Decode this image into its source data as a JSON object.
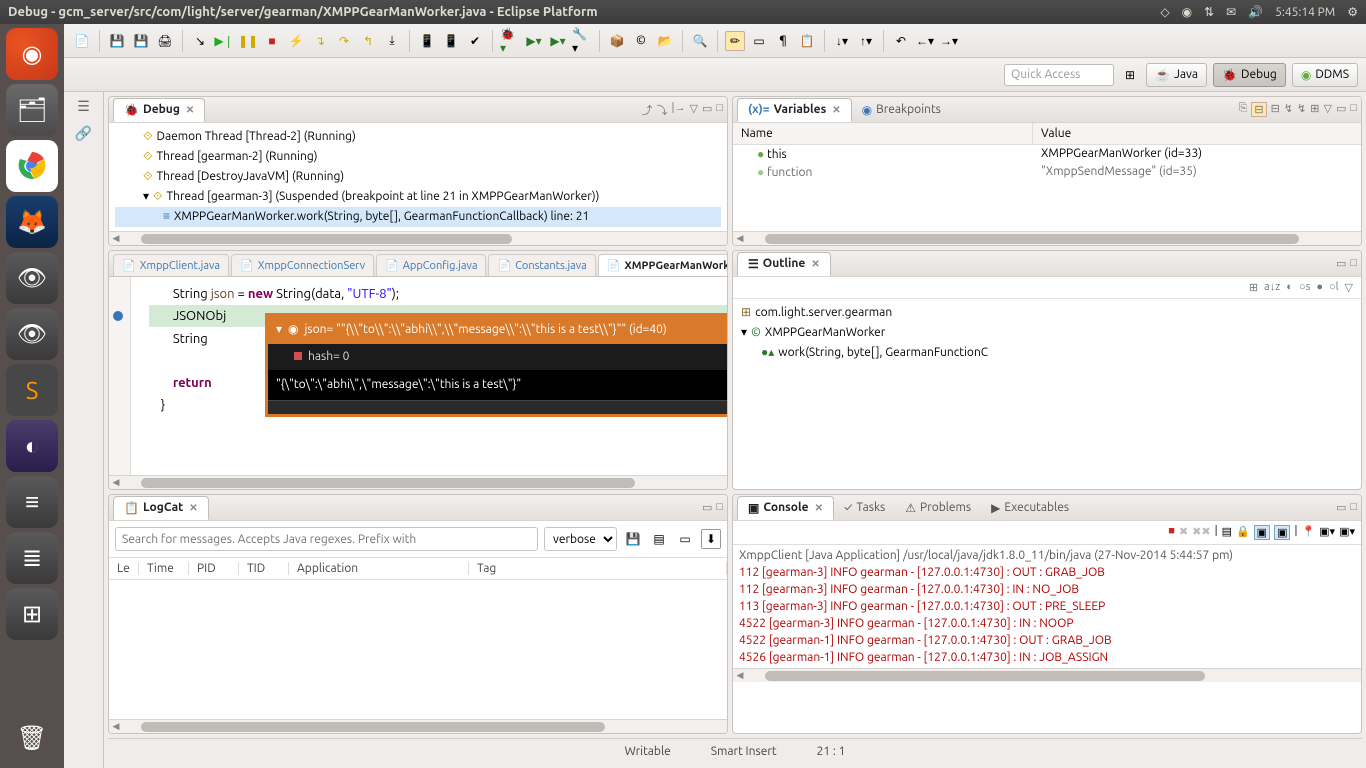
{
  "window_title": "Debug - gcm_server/src/com/light/server/gearman/XMPPGearManWorker.java - Eclipse Platform",
  "time": "5:45:14 PM",
  "quick_access": "Quick Access",
  "perspectives": {
    "java": "Java",
    "debug": "Debug",
    "ddms": "DDMS"
  },
  "debug_view": {
    "title": "Debug",
    "threads": [
      {
        "label": "Daemon Thread [Thread-2] (Running)",
        "indent": 1,
        "icon": "thread"
      },
      {
        "label": "Thread [gearman-2] (Running)",
        "indent": 1,
        "icon": "thread"
      },
      {
        "label": "Thread [DestroyJavaVM] (Running)",
        "indent": 1,
        "icon": "thread"
      },
      {
        "label": "Thread [gearman-3] (Suspended (breakpoint at line 21 in XMPPGearManWorker))",
        "indent": 1,
        "icon": "thread-susp"
      },
      {
        "label": "XMPPGearManWorker.work(String, byte[], GearmanFunctionCallback) line: 21",
        "indent": 2,
        "icon": "frame",
        "sel": true
      }
    ]
  },
  "variables_view": {
    "title": "Variables",
    "breakpoints_tab": "Breakpoints",
    "col_name": "Name",
    "col_value": "Value",
    "rows": [
      {
        "name": "this",
        "value": "XMPPGearManWorker  (id=33)",
        "icon": "●"
      },
      {
        "name": "function",
        "value": "\"XmppSendMessage\" (id=35)",
        "icon": "●"
      }
    ]
  },
  "editor": {
    "tabs": [
      {
        "label": "XmppClient.java"
      },
      {
        "label": "XmppConnectionServ"
      },
      {
        "label": "AppConfig.java"
      },
      {
        "label": "Constants.java"
      },
      {
        "label": "XMPPGearManWorker.j",
        "active": true
      }
    ],
    "code": {
      "l1_a": "String ",
      "l1_b": "json",
      "l1_c": " = ",
      "l1_d": "new",
      "l1_e": " String(data, ",
      "l1_f": "\"UTF-8\"",
      "l1_g": ");",
      "l2": "JSONObj",
      "l3": "String ",
      "l4": "return",
      "l5": "}"
    },
    "hover": {
      "head": "json= \"\"{\\\\\"to\\\\\":\\\\\"abhi\\\\\",\\\\\"message\\\\\":\\\\\"this is a test\\\\\"}\"\" (id=40)",
      "hash": "hash= 0",
      "value": "\"{\\\"to\\\":\\\"abhi\\\",\\\"message\\\":\\\"this is a test\\\"}\""
    }
  },
  "outline": {
    "title": "Outline",
    "pkg": "com.light.server.gearman",
    "cls": "XMPPGearManWorker",
    "method": "work(String, byte[], GearmanFunctionC"
  },
  "logcat": {
    "title": "LogCat",
    "search_ph": "Search for messages. Accepts Java regexes. Prefix with",
    "level": "verbose",
    "cols": {
      "le": "Le",
      "time": "Time",
      "pid": "PID",
      "tid": "TID",
      "app": "Application",
      "tag": "Tag"
    }
  },
  "console": {
    "title": "Console",
    "tabs": {
      "tasks": "Tasks",
      "problems": "Problems",
      "executables": "Executables"
    },
    "header": "XmppClient [Java Application] /usr/local/java/jdk1.8.0_11/bin/java (27-Nov-2014 5:44:57 pm)",
    "lines": [
      "112 [gearman-3] INFO gearman - [127.0.0.1:4730] : OUT : GRAB_JOB",
      "112 [gearman-3] INFO gearman - [127.0.0.1:4730] : IN : NO_JOB",
      "113 [gearman-3] INFO gearman - [127.0.0.1:4730] : OUT : PRE_SLEEP",
      "4522 [gearman-3] INFO gearman - [127.0.0.1:4730] : IN : NOOP",
      "4522 [gearman-1] INFO gearman - [127.0.0.1:4730] : OUT : GRAB_JOB",
      "4526 [gearman-1] INFO gearman - [127.0.0.1:4730] : IN : JOB_ASSIGN"
    ]
  },
  "status": {
    "writable": "Writable",
    "insert": "Smart Insert",
    "pos": "21 : 1"
  }
}
